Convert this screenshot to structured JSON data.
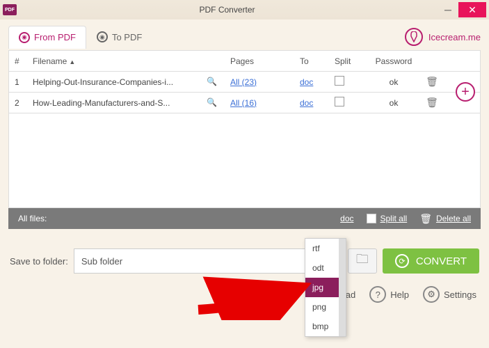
{
  "window": {
    "title": "PDF Converter"
  },
  "tabs": {
    "from": "From PDF",
    "to": "To PDF"
  },
  "brand": "Icecream.me",
  "columns": {
    "num": "#",
    "filename": "Filename",
    "pages": "Pages",
    "to": "To",
    "split": "Split",
    "password": "Password"
  },
  "rows": [
    {
      "num": "1",
      "filename": "Helping-Out-Insurance-Companies-i...",
      "pages": "All (23)",
      "to": "doc",
      "pass": "ok"
    },
    {
      "num": "2",
      "filename": "How-Leading-Manufacturers-and-S...",
      "pages": "All (16)",
      "to": "doc",
      "pass": "ok"
    }
  ],
  "bulk": {
    "label": "All files:",
    "to": "doc",
    "split": "Split all",
    "delete": "Delete all"
  },
  "save": {
    "label": "Save to folder:",
    "value": "Sub folder"
  },
  "convert": "CONVERT",
  "footer": {
    "upgrade": "Upgrad",
    "help": "Help",
    "settings": "Settings"
  },
  "dropdown": [
    "rtf",
    "odt",
    "jpg",
    "png",
    "bmp"
  ],
  "dropdown_selected": "jpg"
}
